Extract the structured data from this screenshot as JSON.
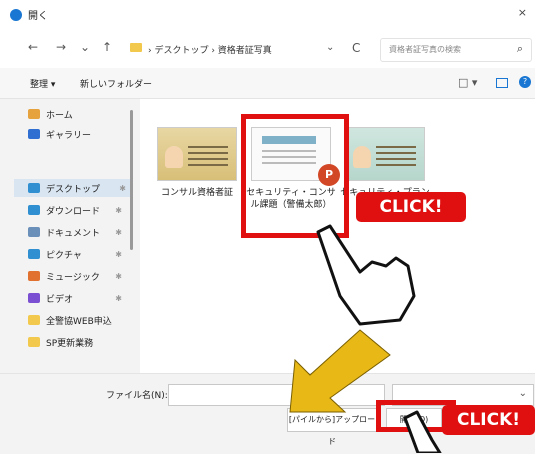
{
  "window": {
    "title": "開く",
    "close_glyph": "×"
  },
  "nav": {
    "back": "←",
    "forward": "→",
    "recent": "⌄",
    "up": "↑",
    "breadcrumb": "› デスクトップ › 資格者証写真",
    "address_chevron": "⌄",
    "refresh": "C",
    "search_placeholder": "資格者証写真の検索",
    "search_icon": "⌕"
  },
  "toolbar": {
    "organize": "整理 ▾",
    "new_folder": "新しいフォルダー",
    "view": "□ ▾"
  },
  "sidebar": {
    "items": [
      {
        "label": "ホーム",
        "icon": "home-icon",
        "color": "#e6a23c"
      },
      {
        "label": "ギャラリー",
        "icon": "gallery-icon",
        "color": "#2f6fd1"
      },
      {
        "label": "デスクトップ",
        "icon": "desktop-icon",
        "color": "#2f8fd1",
        "selected": true
      },
      {
        "label": "ダウンロード",
        "icon": "download-icon",
        "color": "#2f8fd1"
      },
      {
        "label": "ドキュメント",
        "icon": "document-icon",
        "color": "#6a8fb8"
      },
      {
        "label": "ピクチャ",
        "icon": "picture-icon",
        "color": "#2f8fd1"
      },
      {
        "label": "ミュージック",
        "icon": "music-icon",
        "color": "#e0712f"
      },
      {
        "label": "ビデオ",
        "icon": "video-icon",
        "color": "#7a4fd1"
      },
      {
        "label": "全警協WEB申込",
        "icon": "folder-icon",
        "color": "#f2c94c"
      },
      {
        "label": "SP更新業務",
        "icon": "folder-icon",
        "color": "#f2c94c"
      }
    ]
  },
  "files": [
    {
      "name": "コンサル資格者証",
      "kind": "card-yellow"
    },
    {
      "name": "セキュリティ・コンサル課題（警備太郎）",
      "kind": "ppt"
    },
    {
      "name": "セキュリティ・プラン",
      "kind": "card-green"
    }
  ],
  "overlay": {
    "click_label": "CLICK!"
  },
  "footer": {
    "filename_label": "ファイル名(N):",
    "filename_value": "",
    "filetype_value": "",
    "filetype_chevron": "⌄",
    "upload_label": "[パイルから]アップロード",
    "open_label": "開く(O)"
  }
}
